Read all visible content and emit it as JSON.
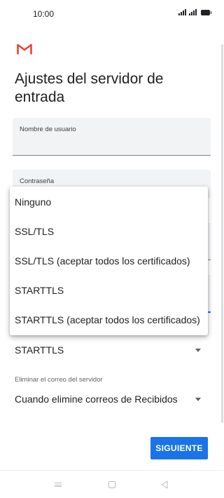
{
  "status_bar": {
    "time": "10:00"
  },
  "header": {
    "app_icon": "gmail-logo-icon",
    "title": "Ajustes del servidor de entrada"
  },
  "fields": {
    "username": {
      "label": "Nombre de usuario",
      "value": ""
    },
    "password": {
      "label": "Contraseña",
      "value": ""
    }
  },
  "security_menu": {
    "options": [
      "Ninguno",
      "SSL/TLS",
      "SSL/TLS (aceptar todos los certificados)",
      "STARTTLS",
      "STARTTLS (aceptar todos los certificados)"
    ]
  },
  "security_type": {
    "selected": "STARTTLS"
  },
  "delete_from_server": {
    "label": "Eliminar el correo del servidor",
    "selected": "Cuando elimine correos de Recibidos"
  },
  "actions": {
    "next_label": "SIGUIENTE"
  },
  "colors": {
    "accent": "#1a73e8",
    "field_bg": "#f1f3f4",
    "gmail_red": "#ea4335"
  },
  "nav_bar": {
    "icons": [
      "menu-icon",
      "home-icon",
      "back-icon"
    ]
  }
}
